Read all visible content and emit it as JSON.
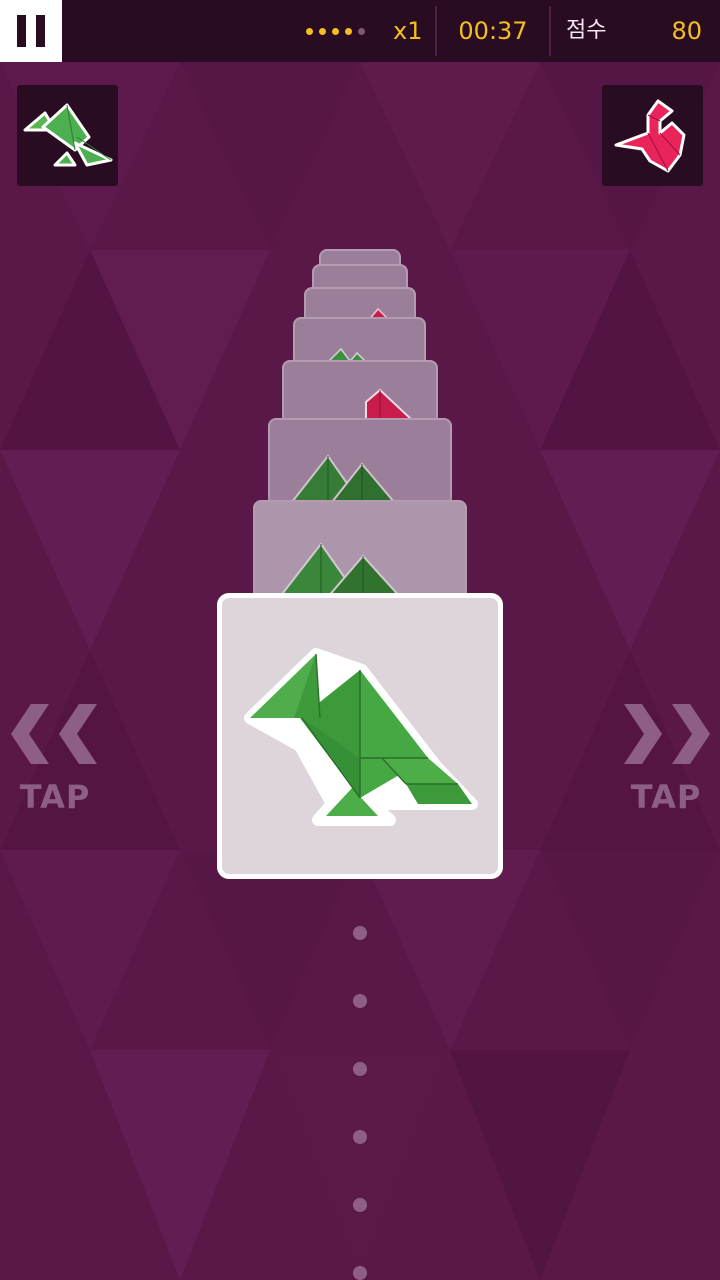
{
  "hud": {
    "combo_dots_filled": 4,
    "combo_dots_total": 5,
    "multiplier": "x1",
    "timer": "00:37",
    "score_label": "점수",
    "score_value": "80"
  },
  "targets": {
    "left": {
      "shape": "bird",
      "color": "#4caf50"
    },
    "right": {
      "shape": "swan",
      "color": "#e8245a"
    }
  },
  "controls": {
    "tap_left": "TAP",
    "tap_right": "TAP"
  },
  "card_stack": {
    "current_shape": "bird",
    "upcoming_shapes": [
      "bird",
      "bird",
      "swan",
      "bird",
      "swan",
      "bird",
      "bird"
    ]
  },
  "colors": {
    "background": "#5a1848",
    "accent": "#f2c01e",
    "bird_green": "#4caf50",
    "swan_red": "#e8245a"
  },
  "queue_dots_count": 6
}
